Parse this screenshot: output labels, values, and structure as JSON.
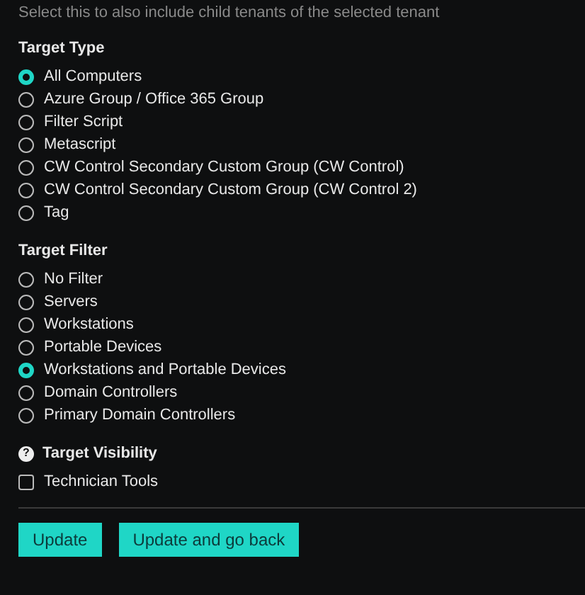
{
  "hint": "Select this to also include child tenants of the selected tenant",
  "target_type": {
    "title": "Target Type",
    "options": [
      {
        "label": "All Computers",
        "selected": true
      },
      {
        "label": "Azure Group / Office 365 Group",
        "selected": false
      },
      {
        "label": "Filter Script",
        "selected": false
      },
      {
        "label": "Metascript",
        "selected": false
      },
      {
        "label": "CW Control Secondary Custom Group (CW Control)",
        "selected": false
      },
      {
        "label": "CW Control Secondary Custom Group (CW Control 2)",
        "selected": false
      },
      {
        "label": "Tag",
        "selected": false
      }
    ]
  },
  "target_filter": {
    "title": "Target Filter",
    "options": [
      {
        "label": "No Filter",
        "selected": false
      },
      {
        "label": "Servers",
        "selected": false
      },
      {
        "label": "Workstations",
        "selected": false
      },
      {
        "label": "Portable Devices",
        "selected": false
      },
      {
        "label": "Workstations and Portable Devices",
        "selected": true
      },
      {
        "label": "Domain Controllers",
        "selected": false
      },
      {
        "label": "Primary Domain Controllers",
        "selected": false
      }
    ]
  },
  "target_visibility": {
    "title": "Target Visibility",
    "help_icon": "?",
    "options": [
      {
        "label": "Technician Tools",
        "checked": false
      }
    ]
  },
  "buttons": [
    "Update",
    "Update and go back"
  ]
}
